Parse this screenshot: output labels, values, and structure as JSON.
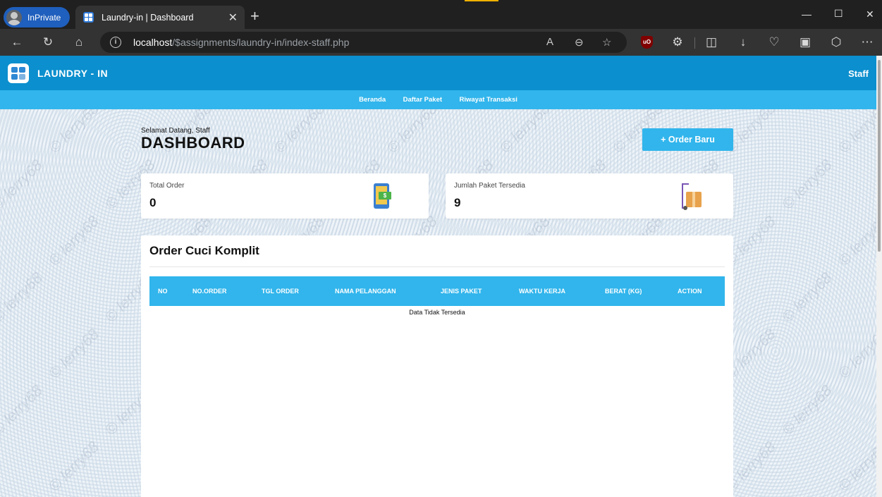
{
  "browser": {
    "inprivate_label": "InPrivate",
    "tab_title": "Laundry-in | Dashboard",
    "url_host": "localhost",
    "url_path": "/$assignments/laundry-in/index-staff.php"
  },
  "header": {
    "brand": "LAUNDRY - IN",
    "user": "Staff"
  },
  "nav": {
    "items": [
      "Beranda",
      "Daftar Paket",
      "Riwayat Transaksi"
    ]
  },
  "page": {
    "welcome": "Selamat Datang, Staff",
    "title": "DASHBOARD",
    "order_button": "+ Order Baru"
  },
  "stats": [
    {
      "label": "Total Order",
      "value": "0"
    },
    {
      "label": "Jumlah Paket Tersedia",
      "value": "9"
    }
  ],
  "orders": {
    "title": "Order Cuci Komplit",
    "columns": [
      "NO",
      "NO.ORDER",
      "TGL ORDER",
      "NAMA PELANGGAN",
      "JENIS PAKET",
      "WAKTU KERJA",
      "BERAT (KG)",
      "ACTION"
    ],
    "empty_text": "Data Tidak Tersedia"
  },
  "watermark": "© lerry68",
  "colors": {
    "primary": "#0b8fce",
    "accent": "#31b5ec"
  }
}
